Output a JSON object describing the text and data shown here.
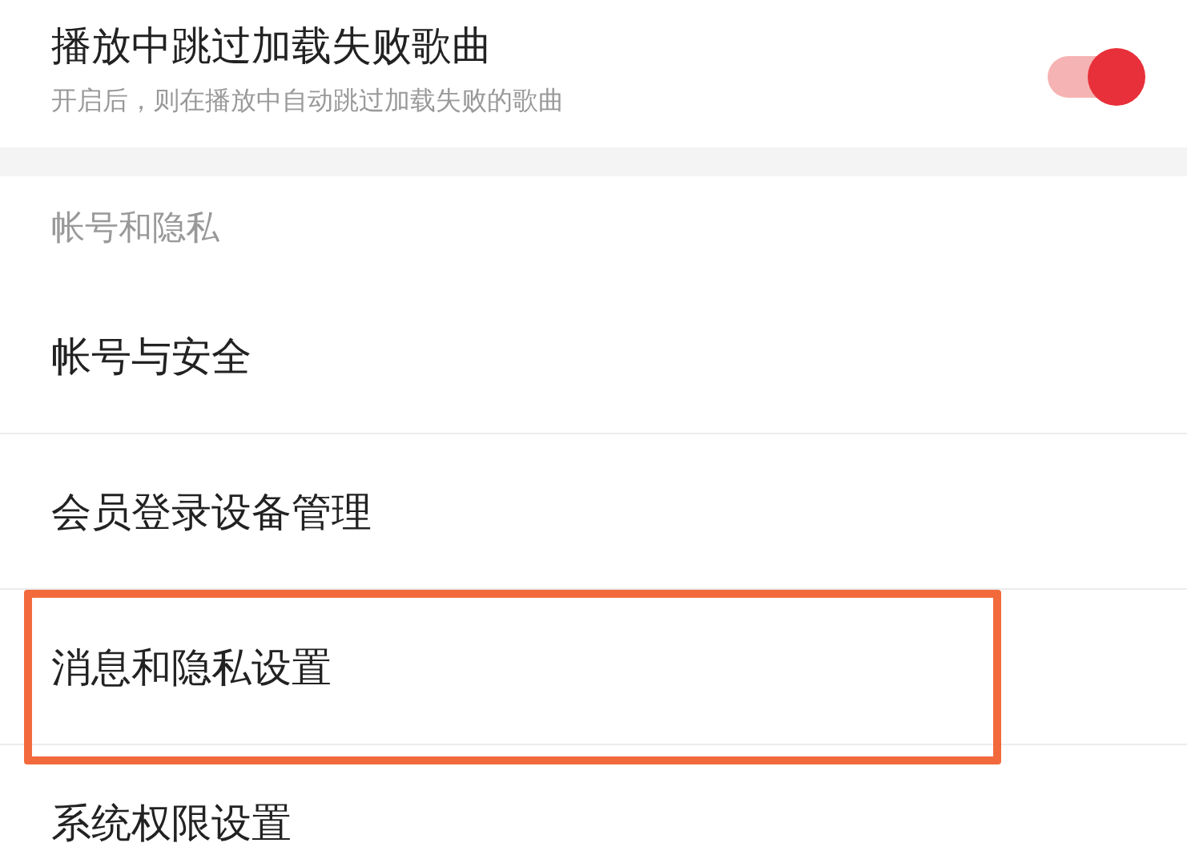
{
  "playback_setting": {
    "title": "播放中跳过加载失败歌曲",
    "description": "开启后，则在播放中自动跳过加载失败的歌曲",
    "on": true
  },
  "section": {
    "header": "帐号和隐私",
    "items": [
      {
        "label": "帐号与安全",
        "highlighted": false
      },
      {
        "label": "会员登录设备管理",
        "highlighted": false
      },
      {
        "label": "消息和隐私设置",
        "highlighted": true
      },
      {
        "label": "系统权限设置",
        "highlighted": false
      }
    ]
  }
}
